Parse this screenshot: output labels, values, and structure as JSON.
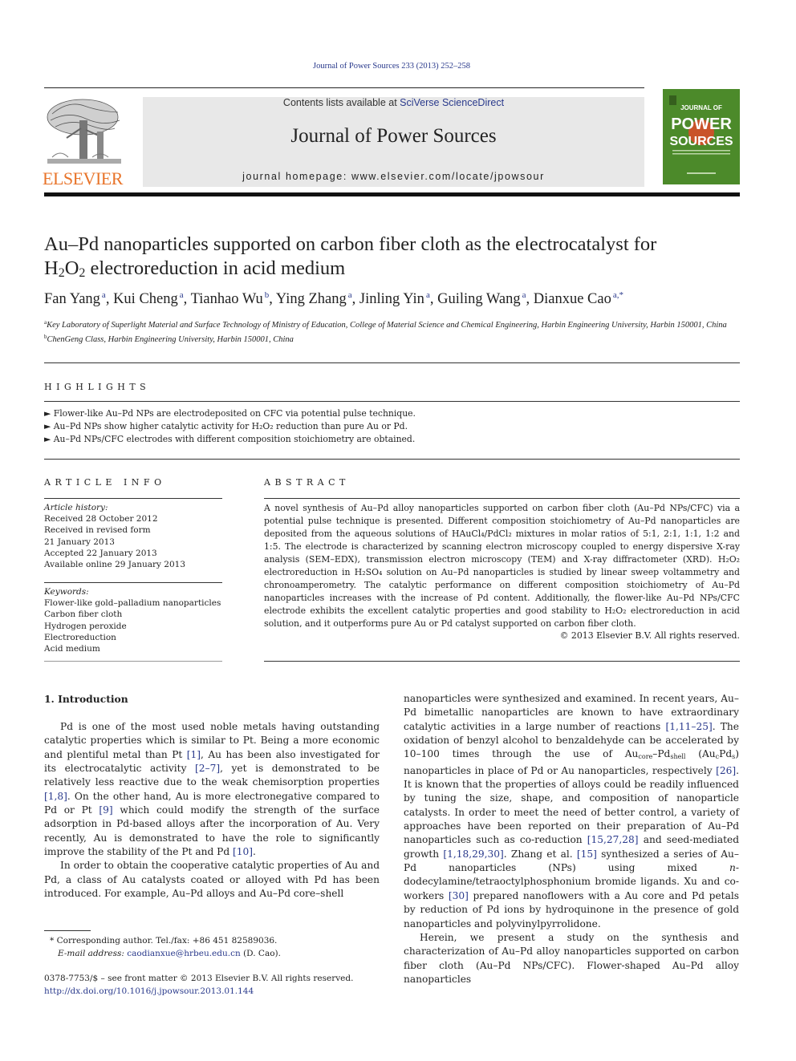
{
  "header": {
    "journal_ref": "Journal of Power Sources 233 (2013) 252–258",
    "contents_prefix": "Contents lists available at ",
    "contents_link": "SciVerse ScienceDirect",
    "journal_title": "Journal of Power Sources",
    "homepage": "journal homepage: www.elsevier.com/locate/jpowsour",
    "publisher_logo_text": "ELSEVIER",
    "publisher_logo_icon": "elsevier-tree-icon",
    "cover_line1": "JOURNAL OF",
    "cover_line2": "POWER",
    "cover_line3": "SOURCES",
    "colors": {
      "link": "#2a3a8c",
      "publisher_orange": "#e8742a",
      "cover_green": "#4c8a2a",
      "masthead_gray": "#e8e8e8"
    }
  },
  "article": {
    "title_part1": "Au–Pd nanoparticles supported on carbon fiber cloth as the electrocatalyst for",
    "title_h": "H",
    "title_sub1": "2",
    "title_o": "O",
    "title_sub2": "2",
    "title_part2": " electroreduction in acid medium",
    "authors": [
      {
        "name": "Fan Yang",
        "aff": "a"
      },
      {
        "name": "Kui Cheng",
        "aff": "a"
      },
      {
        "name": "Tianhao Wu",
        "aff": "b"
      },
      {
        "name": "Ying Zhang",
        "aff": "a"
      },
      {
        "name": "Jinling Yin",
        "aff": "a"
      },
      {
        "name": "Guiling Wang",
        "aff": "a"
      },
      {
        "name": "Dianxue Cao",
        "aff": "a,*"
      }
    ],
    "affiliations": [
      {
        "mark": "a",
        "text": "Key Laboratory of Superlight Material and Surface Technology of Ministry of Education, College of Material Science and Chemical Engineering, Harbin Engineering University, Harbin 150001, China"
      },
      {
        "mark": "b",
        "text": "ChenGeng Class, Harbin Engineering University, Harbin 150001, China"
      }
    ]
  },
  "highlights": {
    "heading": "HIGHLIGHTS",
    "items": [
      "► Flower-like Au–Pd NPs are electrodeposited on CFC via potential pulse technique.",
      "► Au–Pd NPs show higher catalytic activity for H₂O₂ reduction than pure Au or Pd.",
      "► Au–Pd NPs/CFC electrodes with different composition stoichiometry are obtained."
    ]
  },
  "article_info": {
    "heading": "ARTICLE INFO",
    "history_label": "Article history:",
    "history": [
      "Received 28 October 2012",
      "Received in revised form",
      "21 January 2013",
      "Accepted 22 January 2013",
      "Available online 29 January 2013"
    ],
    "keywords_label": "Keywords:",
    "keywords": [
      "Flower-like gold–palladium nanoparticles",
      "Carbon fiber cloth",
      "Hydrogen peroxide",
      "Electroreduction",
      "Acid medium"
    ]
  },
  "abstract": {
    "heading": "ABSTRACT",
    "text": "A novel synthesis of Au–Pd alloy nanoparticles supported on carbon fiber cloth (Au–Pd NPs/CFC) via a potential pulse technique is presented. Different composition stoichiometry of Au–Pd nanoparticles are deposited from the aqueous solutions of HAuCl₄/PdCl₂ mixtures in molar ratios of 5:1, 2:1, 1:1, 1:2 and 1:5. The electrode is characterized by scanning electron microscopy coupled to energy dispersive X-ray analysis (SEM–EDX), transmission electron microscopy (TEM) and X-ray diffractometer (XRD). H₂O₂ electroreduction in H₂SO₄ solution on Au–Pd nanoparticles is studied by linear sweep voltammetry and chronoamperometry. The catalytic performance on different composition stoichiometry of Au–Pd nanoparticles increases with the increase of Pd content. Additionally, the flower-like Au–Pd NPs/CFC electrode exhibits the excellent catalytic properties and good stability to H₂O₂ electroreduction in acid solution, and it outperforms pure Au or Pd catalyst supported on carbon fiber cloth.",
    "copyright": "© 2013 Elsevier B.V. All rights reserved."
  },
  "introduction": {
    "heading": "1.  Introduction",
    "left": {
      "p1_a": "Pd is one of the most used noble metals having outstanding catalytic properties which is similar to Pt. Being a more economic and plentiful metal than Pt ",
      "c1": "[1]",
      "p1_b": ", Au has been also investigated for its electrocatalytic activity ",
      "c2": "[2–7]",
      "p1_c": ", yet is demonstrated to be relatively less reactive due to the weak chemisorption properties ",
      "c3": "[1,8]",
      "p1_d": ". On the other hand, Au is more electronegative compared to Pd or Pt ",
      "c4": "[9]",
      "p1_e": " which could modify the strength of the surface adsorption in Pd-based alloys after the incorporation of Au. Very recently, Au is demonstrated to have the role to significantly improve the stability of the Pt and Pd ",
      "c5": "[10]",
      "p1_f": ".",
      "p2": "In order to obtain the cooperative catalytic properties of Au and Pd, a class of Au catalysts coated or alloyed with Pd has been introduced. For example, Au–Pd alloys and Au–Pd core–shell"
    },
    "right": {
      "p1_a": "nanoparticles were synthesized and examined. In recent years, Au–Pd bimetallic nanoparticles are known to have extraordinary catalytic activities in a large number of reactions ",
      "c1": "[1,11–25]",
      "p1_b": ". The oxidation of benzyl alcohol to benzaldehyde can be accelerated by 10–100 times through the use of Au",
      "sub_core": "core",
      "p1_dash": "–Pd",
      "sub_shell": "shell",
      "p1_paren1": " (Au",
      "sub_c": "c",
      "p1_pd": "Pd",
      "sub_s": "s",
      "p1_c": ") nanoparticles in place of Pd or Au nanoparticles, respectively ",
      "c2": "[26]",
      "p1_d": ". It is known that the properties of alloys could be readily influenced by tuning the size, shape, and composition of nanoparticle catalysts. In order to meet the need of better control, a variety of approaches have been reported on their preparation of Au–Pd nanoparticles such as co-reduction ",
      "c3": "[15,27,28]",
      "p1_e": " and seed-mediated growth ",
      "c4": "[1,18,29,30]",
      "p1_f": ". Zhang et al. ",
      "c5": "[15]",
      "p1_g": " synthesized a series of Au–Pd nanoparticles (NPs) using mixed ",
      "n_italic": "n",
      "p1_h": "-dodecylamine/tetraoctylphosphonium bromide ligands. Xu and co-workers ",
      "c6": "[30]",
      "p1_i": " prepared nanoflowers with a Au core and Pd petals by reduction of Pd ions by hydroquinone in the presence of gold nanoparticles and polyvinylpyrrolidone.",
      "p2": "Herein, we present a study on the synthesis and characterization of Au–Pd alloy nanoparticles supported on carbon fiber cloth (Au–Pd NPs/CFC). Flower-shaped Au–Pd alloy nanoparticles"
    }
  },
  "footnotes": {
    "corresponding": "* Corresponding author. Tel./fax: +86 451 82589036.",
    "email_label": "E-mail address: ",
    "email": "caodianxue@hrbeu.edu.cn",
    "email_suffix": " (D. Cao).",
    "issn": "0378-7753/$ – see front matter © 2013 Elsevier B.V. All rights reserved.",
    "doi": "http://dx.doi.org/10.1016/j.jpowsour.2013.01.144"
  }
}
